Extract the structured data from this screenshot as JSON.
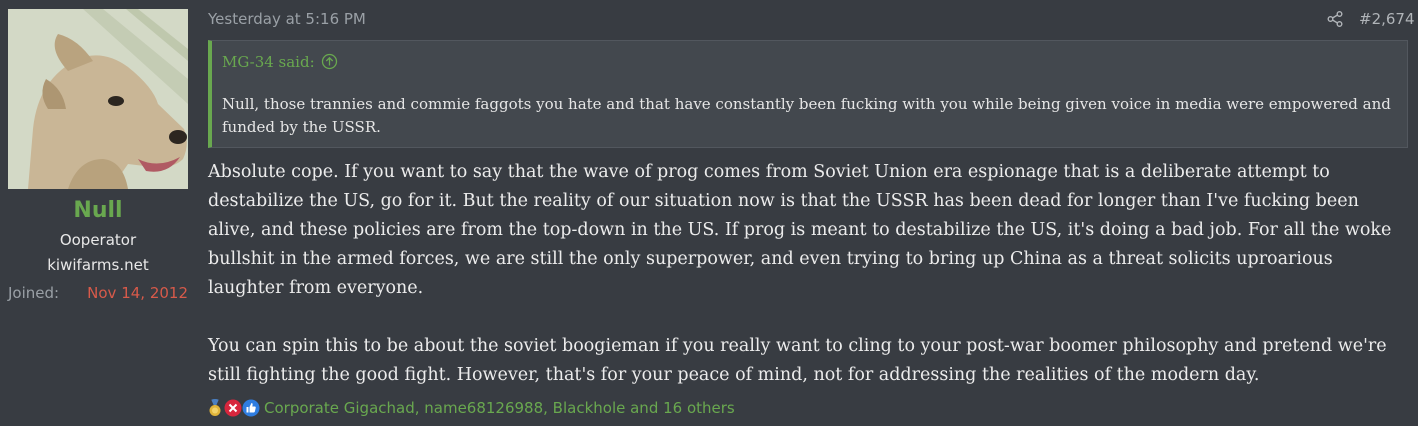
{
  "user": {
    "name": "Null",
    "title": "Ooperator",
    "site": "kiwifarms.net",
    "joined_label": "Joined:",
    "joined_date": "Nov 14, 2012"
  },
  "post": {
    "timestamp": "Yesterday at 5:16 PM",
    "number": "#2,674",
    "quote": {
      "author_line": "MG-34 said:",
      "text": "Null, those trannies and commie faggots you hate and that have constantly been fucking with you while being given voice in media were empowered and funded by the USSR."
    },
    "paragraphs": [
      "Absolute cope. If you want to say that the wave of prog comes from Soviet Union era espionage that is a deliberate attempt to destabilize the US, go for it. But the reality of our situation now is that the USSR has been dead for longer than I've fucking been alive, and these policies are from the top-down in the US. If prog is meant to destabilize the US, it's doing a bad job. For all the woke bullshit in the armed forces, we are still the only superpower, and even trying to bring up China as a threat solicits uproarious laughter from everyone.",
      "You can spin this to be about the soviet boogieman if you really want to cling to your post-war boomer philosophy and pretend we're still fighting the good fight. However, that's for your peace of mind, not for addressing the realities of the modern day."
    ],
    "reactions": {
      "icons": [
        "medal-icon",
        "x-icon",
        "thumbs-up-icon"
      ],
      "text": "Corporate Gigachad, name68126988, Blackhole and 16 others"
    }
  },
  "colors": {
    "background": "#383c42",
    "accent_green": "#69a84f",
    "joined_date_red": "#d75a4a",
    "quote_bg": "#43484e"
  }
}
